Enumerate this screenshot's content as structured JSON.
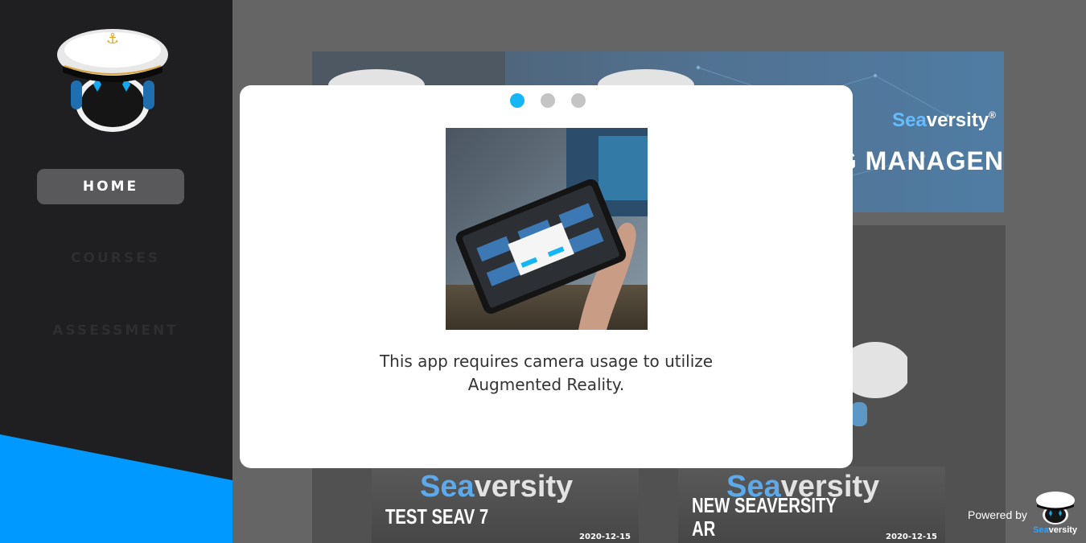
{
  "sidebar": {
    "items": [
      {
        "label": "HOME",
        "active": true
      },
      {
        "label": "COURSES",
        "active": false
      },
      {
        "label": "ASSESSMENT",
        "active": false
      }
    ]
  },
  "banner": {
    "brand_sea": "Sea",
    "brand_versity": "versity",
    "brand_mark": "®",
    "text": "G MANAGEN"
  },
  "courses": [
    {
      "brand_sea": "Sea",
      "brand_versity": "versity",
      "title": "TEST SEAV 7",
      "date": "2020-12-15"
    },
    {
      "brand_sea": "Sea",
      "brand_versity": "versity",
      "title": "NEW SEAVERSITY\nAR",
      "date": "2020-12-15"
    }
  ],
  "footer": {
    "powered_by": "Powered by",
    "brand_sea": "Sea",
    "brand_versity": "versity"
  },
  "modal": {
    "pages": 3,
    "active_page": 0,
    "message": "This app requires camera usage to utilize Augmented Reality."
  },
  "colors": {
    "accent": "#14b6f5",
    "sidebar_bg": "#1f1e20",
    "wedge_blue": "#0099ff",
    "nav_active_bg": "#59585a"
  }
}
